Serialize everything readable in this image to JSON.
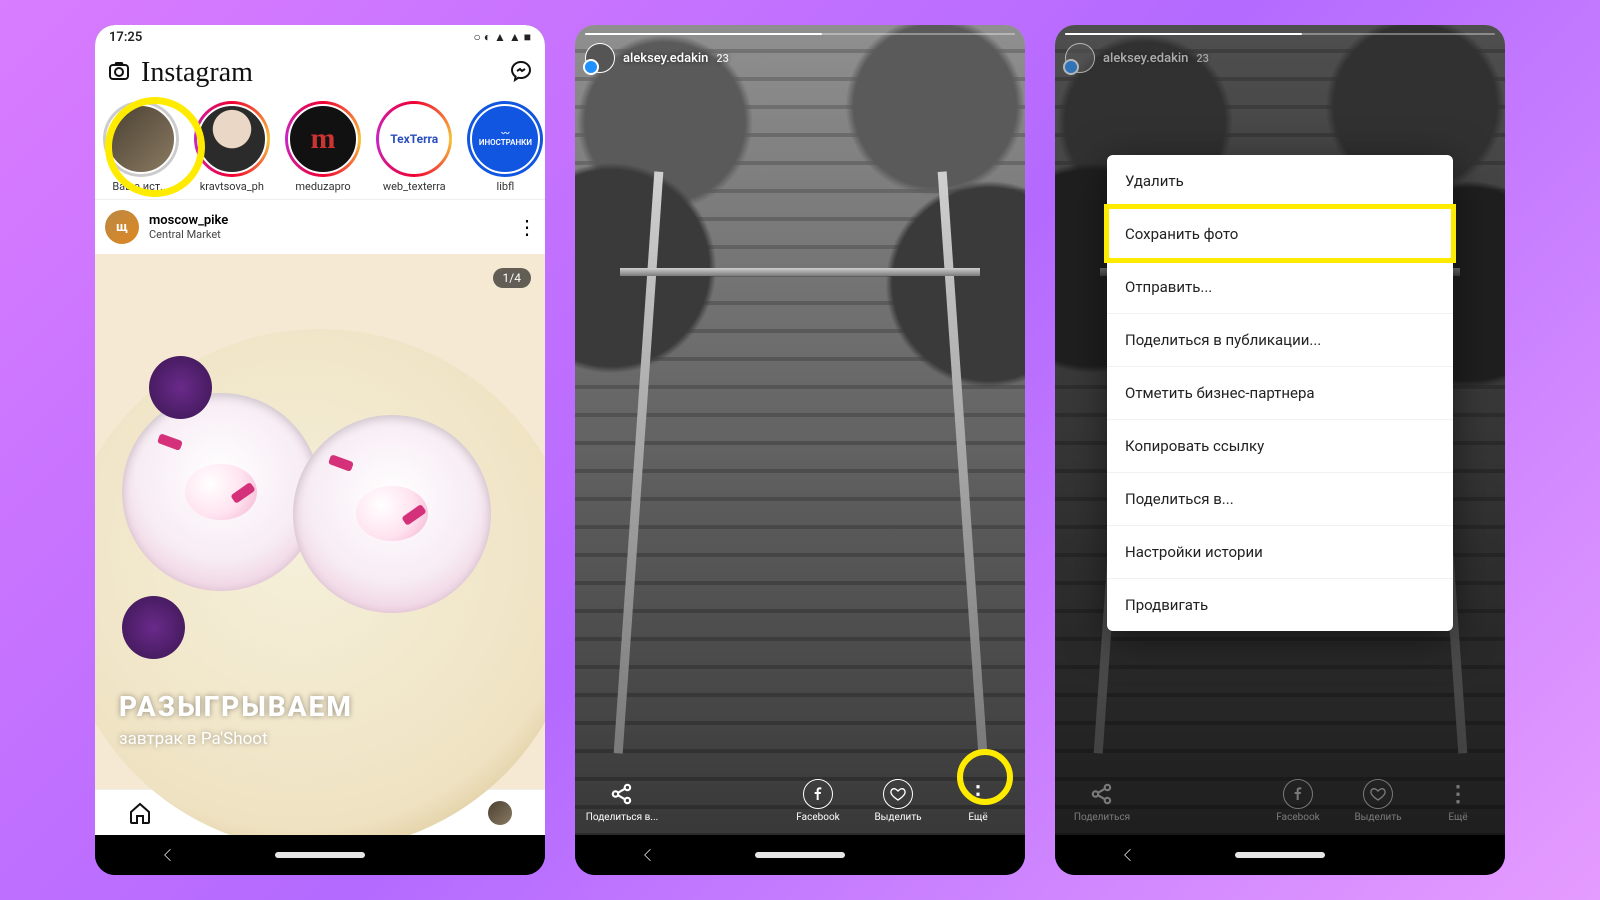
{
  "phone1": {
    "status_time": "17:25",
    "app_name": "Instagram",
    "stories": [
      {
        "label": "Ваша ист...",
        "kind": "self"
      },
      {
        "label": "kravtsova_ph",
        "kind": "grad"
      },
      {
        "label": "meduzapro",
        "kind": "grad",
        "avatar_text": "m",
        "avatar_bg": "#111",
        "avatar_color": "#c33"
      },
      {
        "label": "web_texterra",
        "kind": "grad",
        "avatar_text": "TexTerra",
        "avatar_bg": "#fff",
        "avatar_color": "#3158b7"
      },
      {
        "label": "libfl",
        "kind": "blue",
        "avatar_text": "~\nИНОСТРАНКИ",
        "avatar_bg": "#1156e0"
      }
    ],
    "post": {
      "avatar_letter": "щ",
      "username": "moscow_pike",
      "location": "Central Market",
      "counter": "1/4",
      "caption_title": "РАЗЫГРЫВАЕМ",
      "caption_sub": "завтрак в Pa'Shoot"
    }
  },
  "phone2": {
    "username": "aleksey.edakin",
    "time_ago": "23",
    "actions": {
      "share": "Поделиться в...",
      "facebook": "Facebook",
      "highlight": "Выделить",
      "more": "Ещё"
    }
  },
  "phone3": {
    "username": "aleksey.edakin",
    "time_ago": "23",
    "menu": [
      "Удалить",
      "Сохранить фото",
      "Отправить...",
      "Поделиться в публикации...",
      "Отметить бизнес-партнера",
      "Копировать ссылку",
      "Поделиться в...",
      "Настройки истории",
      "Продвигать"
    ],
    "highlight_index": 1,
    "actions": {
      "share": "Поделиться",
      "facebook": "Facebook",
      "highlight": "Выделить",
      "more": "Ещё"
    }
  }
}
